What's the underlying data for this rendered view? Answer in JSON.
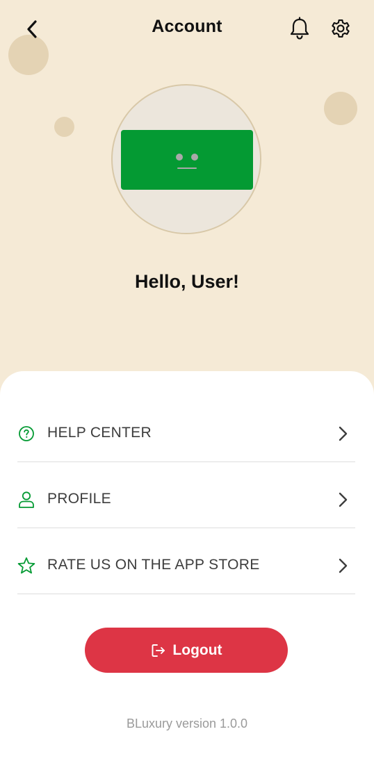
{
  "header": {
    "title": "Account",
    "back_icon": "chevron-left-icon",
    "notification_icon": "bell-icon",
    "settings_icon": "gear-icon"
  },
  "profile": {
    "greeting": "Hello, User!",
    "avatar_icon": "avatar-placeholder-icon"
  },
  "menu": {
    "items": [
      {
        "label": "HELP CENTER",
        "icon": "help-circle-icon"
      },
      {
        "label": "PROFILE",
        "icon": "person-icon"
      },
      {
        "label": "RATE US ON THE APP STORE",
        "icon": "star-icon"
      }
    ],
    "chevron_icon": "chevron-right-icon"
  },
  "logout": {
    "label": "Logout",
    "icon": "logout-icon"
  },
  "footer": {
    "version": "BLuxury version 1.0.0"
  },
  "colors": {
    "hero_background": "#f5ead6",
    "accent_green": "#049a33",
    "logout_red": "#dd3545",
    "text_dark": "#111111",
    "muted_text": "#9a9a9a"
  }
}
